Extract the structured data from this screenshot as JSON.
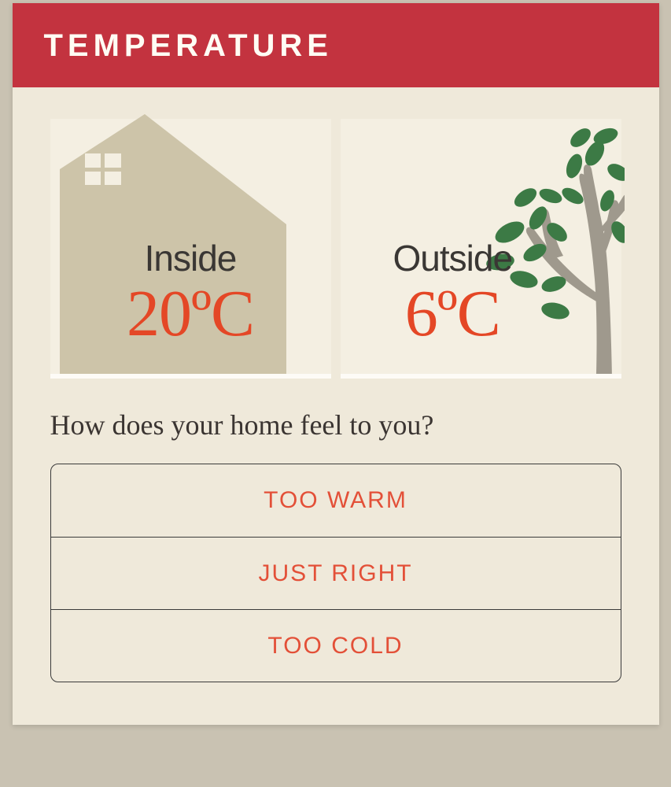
{
  "header": {
    "title": "TEMPERATURE"
  },
  "inside": {
    "label": "Inside",
    "temp": "20ºC"
  },
  "outside": {
    "label": "Outside",
    "temp": "6ºC"
  },
  "question": "How does your home feel to you?",
  "options": {
    "warm": "TOO WARM",
    "right": "JUST RIGHT",
    "cold": "TOO COLD"
  }
}
